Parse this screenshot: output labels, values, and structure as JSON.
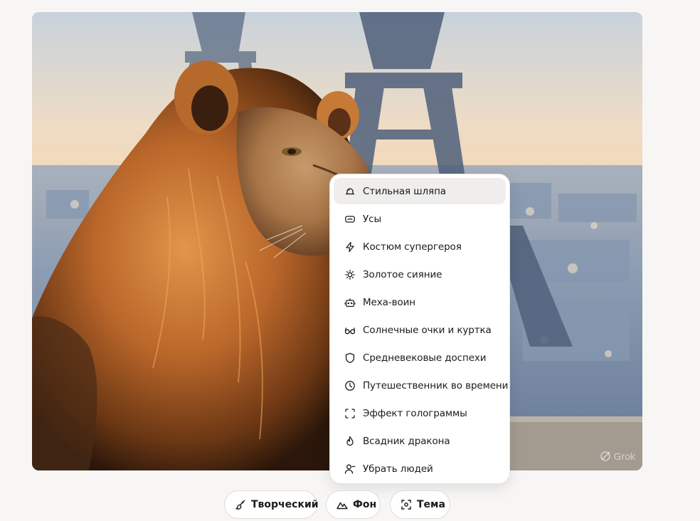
{
  "image": {
    "subject": "lion-near-eiffel-tower",
    "watermark": "Grok"
  },
  "menu": {
    "items": [
      {
        "label": "Стильная шляпа",
        "icon": "hat-icon",
        "active": true
      },
      {
        "label": "Усы",
        "icon": "mustache-icon",
        "active": false
      },
      {
        "label": "Костюм супергероя",
        "icon": "lightning-icon",
        "active": false
      },
      {
        "label": "Золотое сияние",
        "icon": "sun-icon",
        "active": false
      },
      {
        "label": "Меха-воин",
        "icon": "robot-icon",
        "active": false
      },
      {
        "label": "Солнечные очки и куртка",
        "icon": "glasses-icon",
        "active": false
      },
      {
        "label": "Средневековые доспехи",
        "icon": "shield-icon",
        "active": false
      },
      {
        "label": "Путешественник во времени",
        "icon": "clock-icon",
        "active": false
      },
      {
        "label": "Эффект голограммы",
        "icon": "frame-corners-icon",
        "active": false
      },
      {
        "label": "Всадник дракона",
        "icon": "flame-icon",
        "active": false
      },
      {
        "label": "Убрать людей",
        "icon": "user-remove-icon",
        "active": false
      }
    ]
  },
  "toolbar": {
    "creative_label": "Творческий",
    "creative_icon": "brush-icon",
    "background_label": "Фон",
    "background_icon": "mountains-icon",
    "theme_label": "Тема",
    "theme_icon": "focus-icon"
  },
  "colors": {
    "page_bg": "#f7f6f5",
    "menu_bg": "#ffffff",
    "active_item_bg": "#efeeec",
    "text": "#1b1b1b"
  }
}
